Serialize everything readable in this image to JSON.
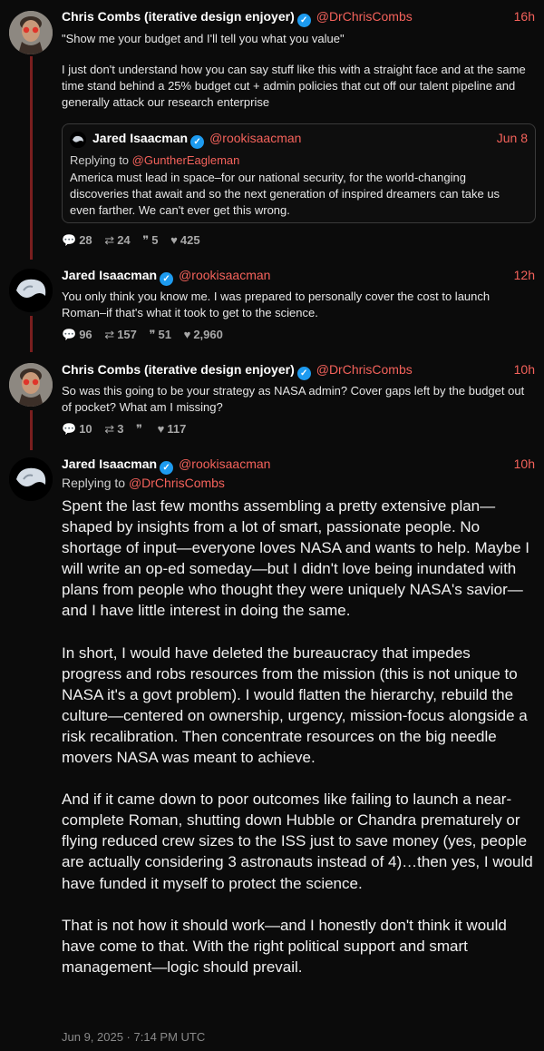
{
  "tweets": [
    {
      "name": "Chris Combs (iterative design enjoyer)",
      "handle": "@DrChrisCombs",
      "time": "16h",
      "lines": [
        "\"Show me your budget and I'll tell you what you value\"",
        "I just don't understand how you can say stuff like this with a straight face and at the same time stand behind a 25% budget cut + admin policies that cut off our talent pipeline and generally attack our research enterprise"
      ],
      "quote": {
        "name": "Jared Isaacman",
        "handle": "@rookisaacman",
        "time": "Jun 8",
        "replying_prefix": "Replying to ",
        "replying_to": "@GuntherEagleman",
        "text": "America must lead in space–for our national security, for the world-changing discoveries that await and so the next generation of inspired dreamers can take us even farther. We can't ever get this wrong."
      },
      "stats": {
        "replies": "28",
        "retweets": "24",
        "quotes": "5",
        "likes": "425"
      }
    },
    {
      "name": "Jared Isaacman",
      "handle": "@rookisaacman",
      "time": "12h",
      "text": "You only think you know me. I was prepared to personally cover the cost to launch Roman–if that's what it took to get to the science.",
      "stats": {
        "replies": "96",
        "retweets": "157",
        "quotes": "51",
        "likes": "2,960"
      }
    },
    {
      "name": "Chris Combs (iterative design enjoyer)",
      "handle": "@DrChrisCombs",
      "time": "10h",
      "text": "So was this going to be your strategy as NASA admin? Cover gaps left by the budget out of pocket? What am I missing?",
      "stats": {
        "replies": "10",
        "retweets": "3",
        "quotes": "",
        "likes": "117"
      }
    },
    {
      "name": "Jared Isaacman",
      "handle": "@rookisaacman",
      "time": "10h",
      "replying_prefix": "Replying to ",
      "replying_to": "@DrChrisCombs",
      "paragraphs": [
        "Spent the last few months assembling a pretty extensive plan—shaped by insights from a lot of smart, passionate people. No shortage of input—everyone loves NASA and wants to help. Maybe I will write an op-ed someday—but I didn't love being inundated with plans from people who thought they were uniquely NASA's savior—and I have little interest in doing the same.",
        "In short, I would have deleted the bureaucracy that impedes progress and robs resources from the mission (this is not unique to NASA it's a govt problem). I would flatten the hierarchy, rebuild the culture—centered on ownership, urgency, mission-focus alongside a risk recalibration. Then concentrate resources on the big needle movers NASA was meant to achieve.",
        "And if it came down to poor outcomes like failing to launch a near-complete Roman, shutting down Hubble or Chandra prematurely or flying reduced crew sizes to the ISS just to save money (yes, people are actually considering 3 astronauts instead of 4)…then yes, I would have funded it myself to protect the science.",
        "That is not how it should work—and I honestly don't think it would have come to that. With the right political support and smart management—logic should prevail."
      ],
      "date": "Jun 9, 2025 · 7:14 PM UTC"
    }
  ],
  "icons": {
    "reply": "comment-icon",
    "retweet": "retweet-icon",
    "quote": "quote-icon",
    "like": "heart-icon",
    "verified": "verified-badge-icon"
  },
  "colors": {
    "accent": "#f4625b",
    "thread_line": "#7a1f1f",
    "verified": "#1d9bf0",
    "background": "#0b0b0b"
  }
}
